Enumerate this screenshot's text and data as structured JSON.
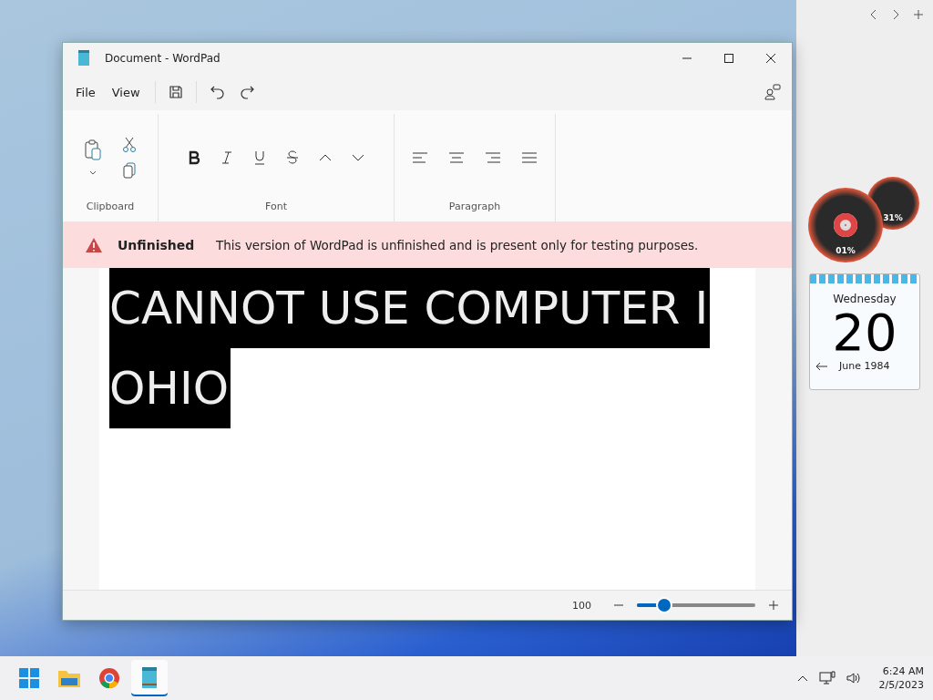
{
  "window": {
    "title": "Document - WordPad"
  },
  "menu": [
    "File",
    "View"
  ],
  "ribbon_groups": [
    {
      "label": "Clipboard",
      "kind": "clipboard"
    },
    {
      "label": "Font",
      "kind": "font"
    },
    {
      "label": "Paragraph",
      "kind": "paragraph"
    }
  ],
  "banner": {
    "title": "Unfinished",
    "message": "This version of WordPad is unfinished and is present only for testing purposes."
  },
  "document": {
    "lines": [
      "CANNOT USE COMPUTER I",
      "OHIO"
    ]
  },
  "status_bar": {
    "zoom": "100",
    "zoom_slider": {
      "level": 0.23
    }
  },
  "gadgets": {
    "gauge_small": "31%",
    "gauge_large": "01%",
    "calendar": {
      "weekday": "Wednesday",
      "day": "20",
      "month_year": "June 1984"
    }
  },
  "taskbar": {
    "apps": [
      {
        "kind": "start",
        "selected": false
      },
      {
        "kind": "folder",
        "selected": false
      },
      {
        "kind": "browser",
        "selected": false
      },
      {
        "kind": "notepad",
        "selected": true
      }
    ],
    "time": "6:24 AM",
    "date": "2/5/2023"
  }
}
